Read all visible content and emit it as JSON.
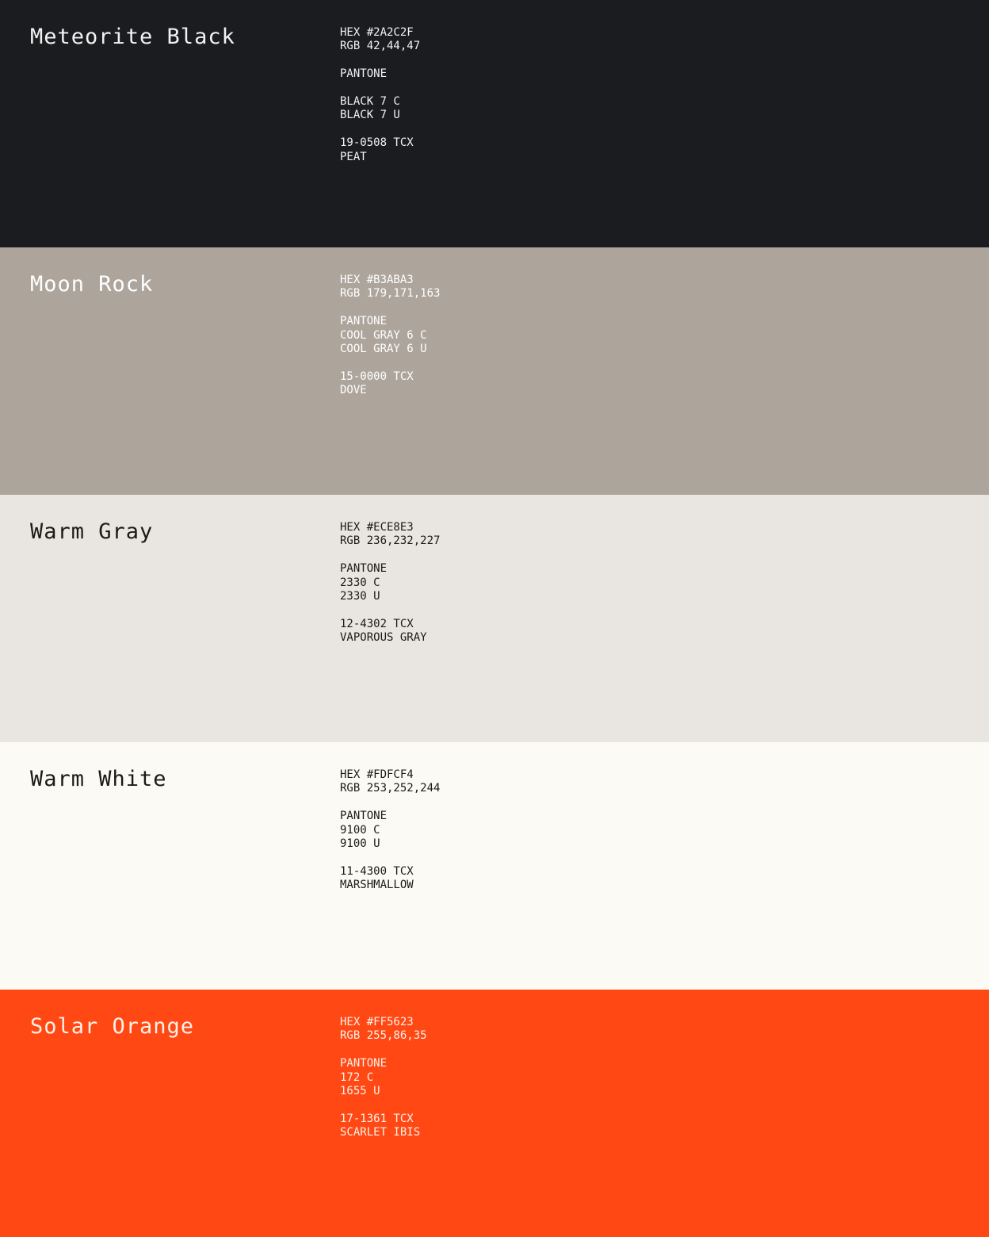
{
  "swatches": [
    {
      "name": "Meteorite Black",
      "background": "#1B1C1F",
      "text_color": "#F2F2F2",
      "groups": [
        [
          "HEX #2A2C2F",
          "RGB 42,44,47"
        ],
        [
          "PANTONE"
        ],
        [
          "BLACK 7 C",
          "BLACK 7 U"
        ],
        [
          "19-0508 TCX",
          "PEAT"
        ]
      ]
    },
    {
      "name": "Moon Rock",
      "background": "#ADA59C",
      "text_color": "#FFFFFF",
      "groups": [
        [
          "HEX #B3ABA3",
          "RGB 179,171,163"
        ],
        [
          "PANTONE",
          "COOL GRAY 6 C",
          "COOL GRAY 6 U"
        ],
        [
          "15-0000 TCX",
          "DOVE"
        ]
      ]
    },
    {
      "name": "Warm Gray",
      "background": "#E9E6E1",
      "text_color": "#1A1A1A",
      "groups": [
        [
          "HEX #ECE8E3",
          "RGB 236,232,227"
        ],
        [
          "PANTONE",
          "2330 C",
          "2330 U"
        ],
        [
          "12-4302 TCX",
          "VAPOROUS GRAY"
        ]
      ]
    },
    {
      "name": "Warm White",
      "background": "#FBFAF4",
      "text_color": "#1A1A1A",
      "groups": [
        [
          "HEX #FDFCF4",
          "RGB 253,252,244"
        ],
        [
          "PANTONE",
          "9100 C",
          "9100 U"
        ],
        [
          "11-4300 TCX",
          "MARSHMALLOW"
        ]
      ]
    },
    {
      "name": "Solar Orange",
      "background": "#FF4813",
      "text_color": "#FFF1E8",
      "groups": [
        [
          "HEX #FF5623",
          "RGB 255,86,35"
        ],
        [
          "PANTONE",
          "172 C",
          "1655 U"
        ],
        [
          "17-1361 TCX",
          "SCARLET IBIS"
        ]
      ]
    }
  ]
}
